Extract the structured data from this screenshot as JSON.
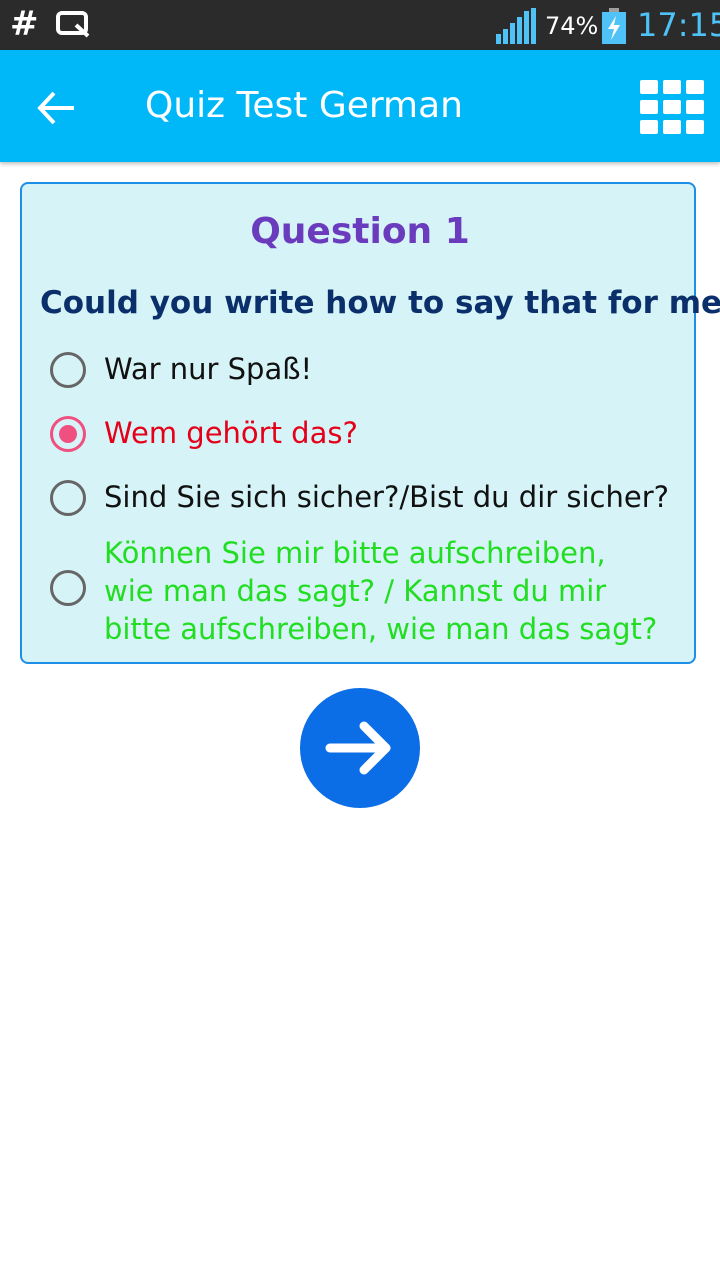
{
  "status_bar": {
    "hash_glyph": "#",
    "battery_percent": "74%",
    "time": "17:15",
    "icons": [
      "screen-cast-icon",
      "signal-icon",
      "battery-charging-icon"
    ]
  },
  "app_bar": {
    "title": "Quiz Test German",
    "background_color": "#00b7f8",
    "icons": [
      "back-arrow-icon",
      "grid-menu-icon"
    ]
  },
  "quiz": {
    "question_title": "Question 1",
    "question_text": "Could you write how to say that for me?",
    "options": [
      {
        "label": "War nur Spaß!",
        "selected": false,
        "color": "#111111"
      },
      {
        "label": "Wem gehört das?",
        "selected": true,
        "color": "#e5001a"
      },
      {
        "label": "Sind Sie sich sicher?/Bist du dir sicher?",
        "selected": false,
        "color": "#111111"
      },
      {
        "label": "Können Sie mir bitte aufschreiben, wie man das sagt? / Kannst du mir bitte aufschreiben, wie man das sagt?",
        "selected": false,
        "color": "#22dd22"
      }
    ]
  },
  "next_button": {
    "icon": "arrow-right-icon",
    "color": "#0b6ee6"
  }
}
